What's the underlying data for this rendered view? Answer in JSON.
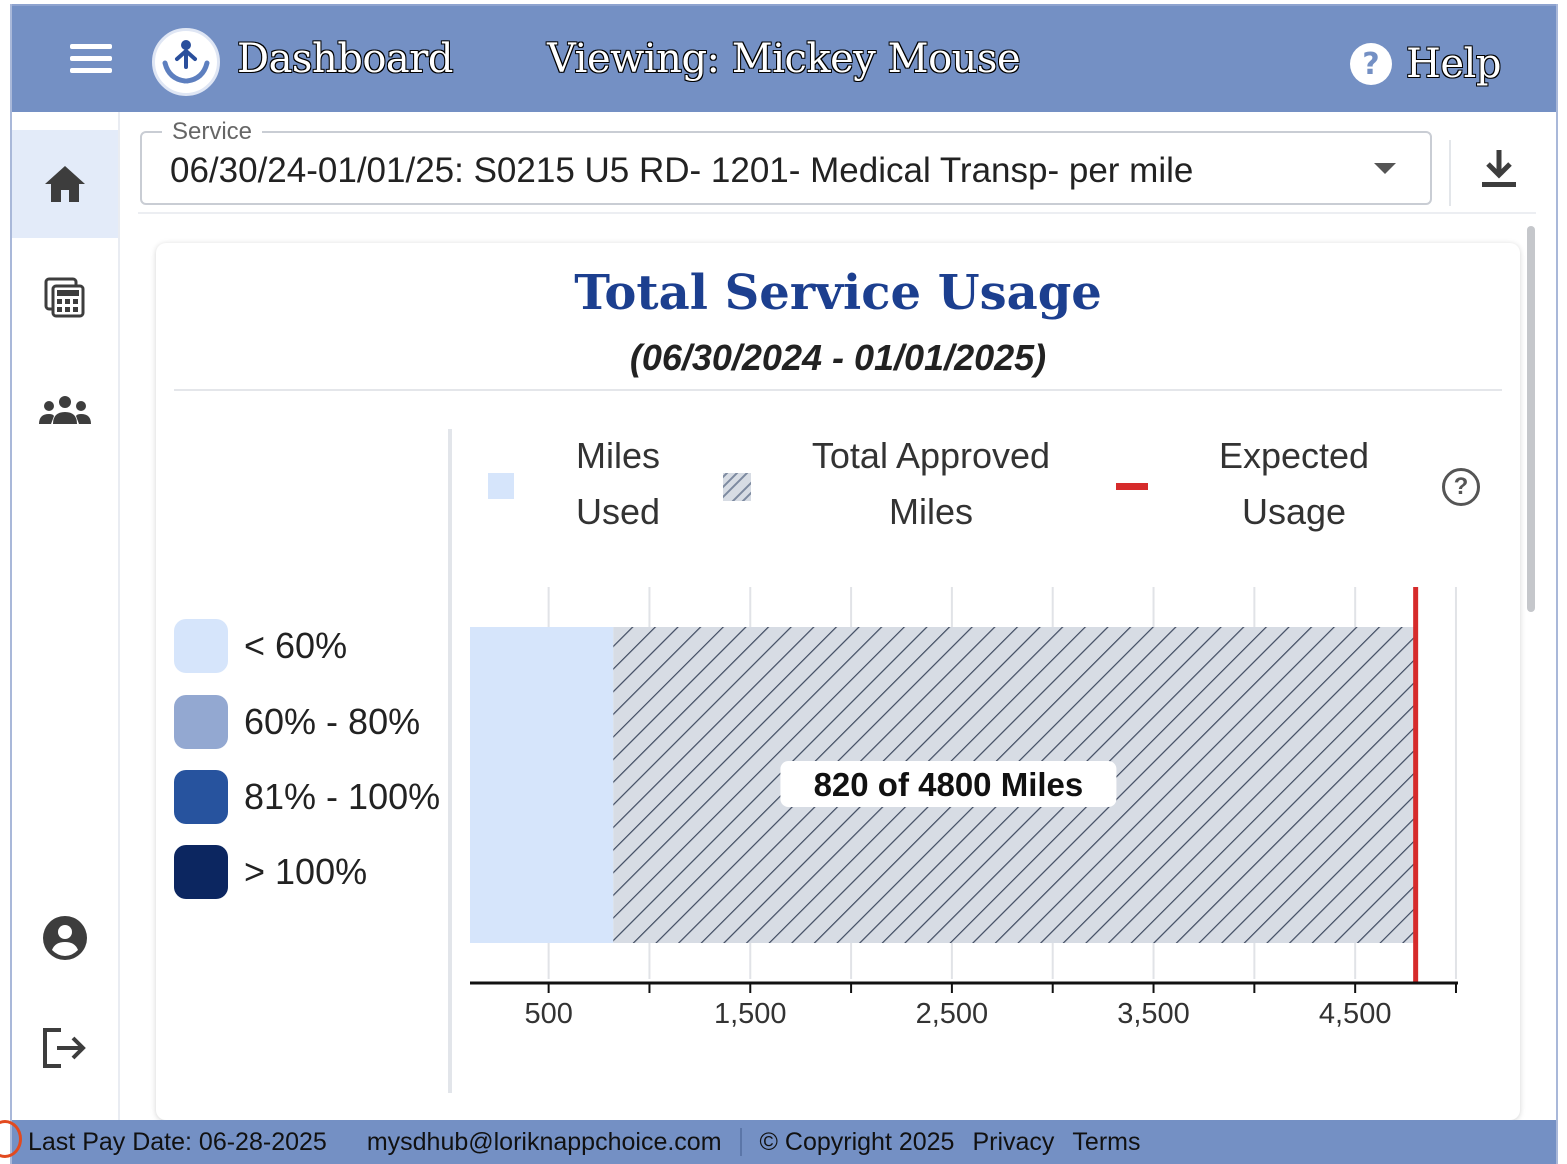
{
  "appbar": {
    "title": "Dashboard",
    "viewing": "Viewing: Mickey Mouse",
    "help_label": "Help",
    "icons": {
      "menu": "menu-icon",
      "logo": "hands-person-logo",
      "help": "help-circle-icon"
    }
  },
  "rail": {
    "items": [
      {
        "name": "home",
        "icon": "home-icon",
        "active": true
      },
      {
        "name": "calculator",
        "icon": "calculator-icon",
        "active": false
      },
      {
        "name": "group",
        "icon": "group-icon",
        "active": false
      },
      {
        "name": "account",
        "icon": "account-circle-icon",
        "active": false
      },
      {
        "name": "logout",
        "icon": "logout-icon",
        "active": false
      }
    ]
  },
  "service": {
    "label": "Service",
    "value": "06/30/24-01/01/25: S0215 U5 RD- 1201- Medical Transp- per mile",
    "download_icon": "download-icon"
  },
  "card": {
    "title": "Total Service Usage",
    "subtitle": "(06/30/2024 - 01/01/2025)"
  },
  "percent_legend": [
    {
      "label": "< 60%",
      "color": "#d6e5fb"
    },
    {
      "label": "60% - 80%",
      "color": "#93a8d1"
    },
    {
      "label": "81% - 100%",
      "color": "#27539e"
    },
    {
      "label": "> 100%",
      "color": "#0c2660"
    }
  ],
  "series_legend": {
    "miles_used": {
      "line1": "Miles",
      "line2": "Used"
    },
    "total_approved": {
      "line1": "Total Approved",
      "line2": "Miles"
    },
    "expected": {
      "line1": "Expected",
      "line2": "Usage"
    },
    "help_icon": "help-outline-icon",
    "help_text": "?"
  },
  "chart_data": {
    "type": "bar",
    "orientation": "horizontal",
    "series": [
      {
        "name": "Miles Used",
        "value": 820,
        "color": "#d6e5fb"
      },
      {
        "name": "Total Approved Miles",
        "value": 4800,
        "pattern": "hatched",
        "color": "#d7dce4"
      },
      {
        "name": "Expected Usage",
        "value": 4800,
        "marker": "line",
        "color": "#d62b2b"
      }
    ],
    "annotation": "820 of 4800 Miles",
    "xlim": [
      110,
      5010
    ],
    "xticks": [
      500,
      1000,
      1500,
      2000,
      2500,
      3000,
      3500,
      4000,
      4500,
      5000
    ],
    "xtick_labels": [
      {
        "value": 500,
        "label": "500"
      },
      {
        "value": 1500,
        "label": "1,500"
      },
      {
        "value": 2500,
        "label": "2,500"
      },
      {
        "value": 3500,
        "label": "3,500"
      },
      {
        "value": 4500,
        "label": "4,500"
      }
    ],
    "grid": true
  },
  "footer": {
    "last_pay": "Last Pay Date: 06-28-2025",
    "email": "mysdhub@loriknappchoice.com",
    "copyright": "© Copyright 2025",
    "privacy": "Privacy",
    "terms": "Terms"
  }
}
